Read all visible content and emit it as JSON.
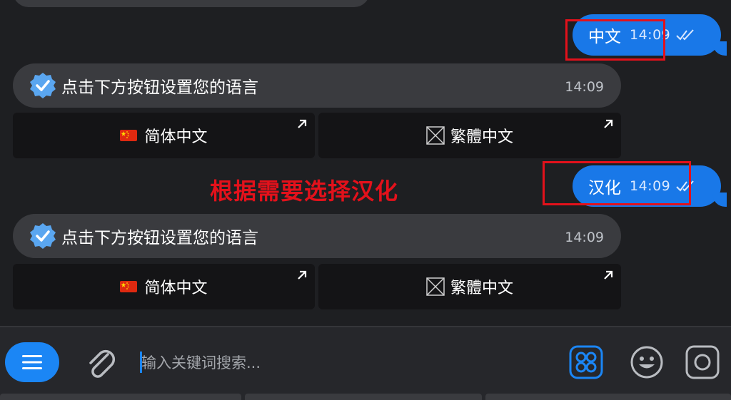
{
  "messages": [
    {
      "type": "outgoing",
      "text": "中文",
      "time": "14:09"
    },
    {
      "type": "incoming",
      "text": "点击下方按钮设置您的语言",
      "time": "14:09",
      "buttons": [
        {
          "label": "简体中文",
          "icon": "china-flag-icon"
        },
        {
          "label": "繁體中文",
          "icon": "missing-glyph-icon"
        }
      ]
    },
    {
      "type": "outgoing",
      "text": "汉化",
      "time": "14:09"
    },
    {
      "type": "incoming",
      "text": "点击下方按钮设置您的语言",
      "time": "14:09",
      "buttons": [
        {
          "label": "简体中文",
          "icon": "china-flag-icon"
        },
        {
          "label": "繁體中文",
          "icon": "missing-glyph-icon"
        }
      ]
    }
  ],
  "annotation": {
    "text": "根据需要选择汉化",
    "color": "#e3111b"
  },
  "input": {
    "placeholder": "输入关键词搜索..."
  },
  "colors": {
    "accent": "#1b86f5",
    "outgoing_bubble": "#1978e8",
    "incoming_bubble": "#3a3b3f",
    "button_bg": "#141416",
    "background": "#1e1f22",
    "highlight": "#e3111b"
  },
  "icons": [
    "menu-icon",
    "paperclip-icon",
    "grid-icon",
    "emoji-icon",
    "camera-icon",
    "double-check-icon",
    "verified-badge-icon",
    "open-arrow-icon"
  ]
}
